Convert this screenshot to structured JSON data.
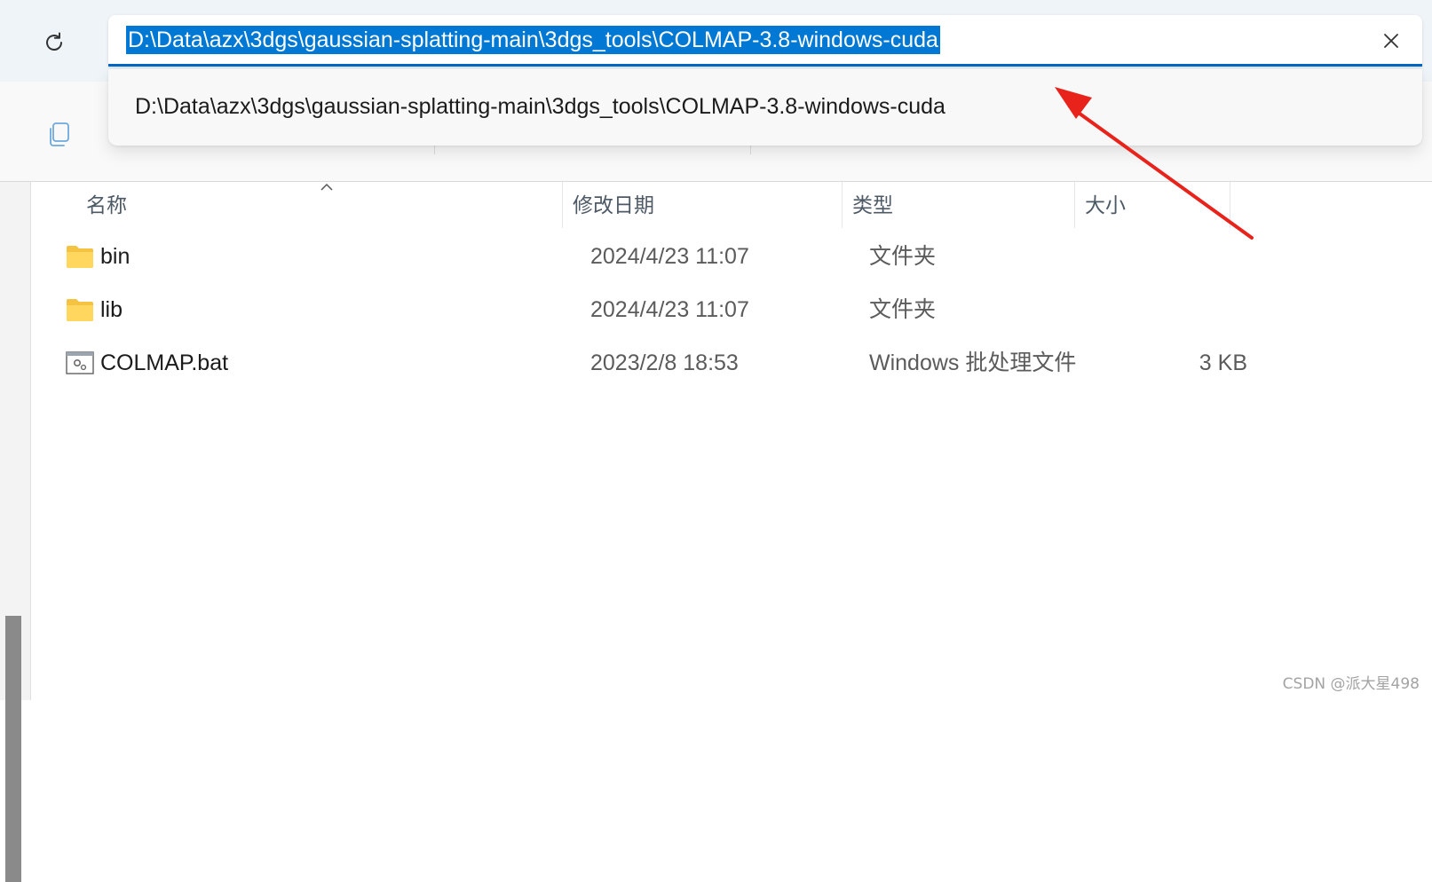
{
  "address_bar": {
    "path": "D:\\Data\\azx\\3dgs\\gaussian-splatting-main\\3dgs_tools\\COLMAP-3.8-windows-cuda"
  },
  "suggestion": {
    "text": "D:\\Data\\azx\\3dgs\\gaussian-splatting-main\\3dgs_tools\\COLMAP-3.8-windows-cuda"
  },
  "columns": {
    "name": "名称",
    "date": "修改日期",
    "type": "类型",
    "size": "大小"
  },
  "files": [
    {
      "name": "bin",
      "date": "2024/4/23 11:07",
      "type": "文件夹",
      "size": "",
      "icon": "folder-icon"
    },
    {
      "name": "lib",
      "date": "2024/4/23 11:07",
      "type": "文件夹",
      "size": "",
      "icon": "folder-icon"
    },
    {
      "name": "COLMAP.bat",
      "date": "2023/2/8 18:53",
      "type": "Windows 批处理文件",
      "size": "3 KB",
      "icon": "batch-file-icon"
    }
  ],
  "watermark": "CSDN @派大星498",
  "colors": {
    "accent": "#0078d4",
    "annotation_arrow": "#e8231b"
  }
}
